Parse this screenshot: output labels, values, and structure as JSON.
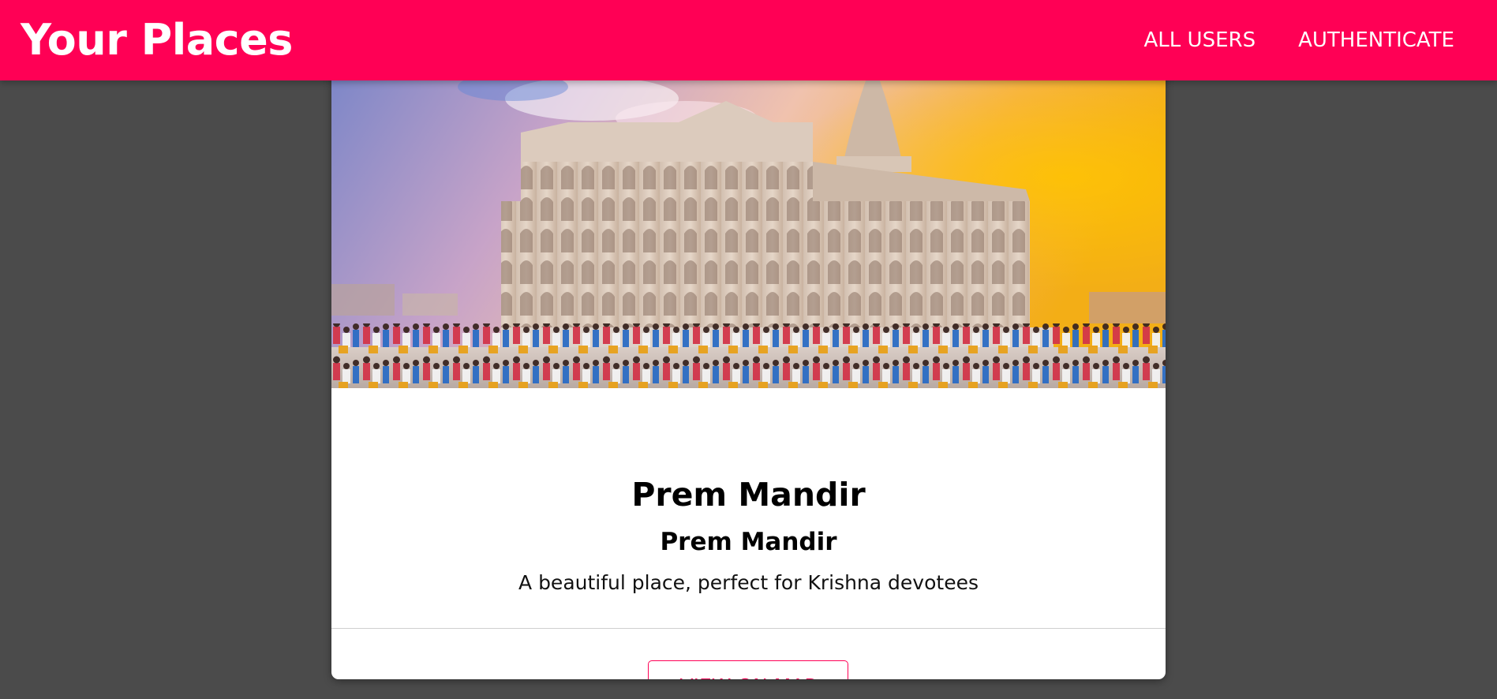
{
  "header": {
    "brand": "Your Places",
    "nav": [
      {
        "label": "ALL USERS"
      },
      {
        "label": "AUTHENTICATE"
      }
    ]
  },
  "place": {
    "image_alt": "Prem Mandir",
    "title": "Prem Mandir",
    "address": "Prem Mandir",
    "description": "A beautiful place, perfect for Krishna devotees",
    "view_on_map_label": "VIEW ON MAP"
  },
  "colors": {
    "accent": "#ff0055",
    "background": "#4b4b4b",
    "card": "#ffffff"
  }
}
